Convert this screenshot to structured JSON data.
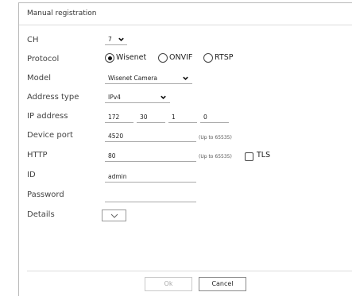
{
  "dialog": {
    "title": "Manual registration"
  },
  "fields": {
    "ch": {
      "label": "CH",
      "value": "7"
    },
    "protocol": {
      "label": "Protocol",
      "options": [
        "Wisenet",
        "ONVIF",
        "RTSP"
      ],
      "selected": "Wisenet"
    },
    "model": {
      "label": "Model",
      "value": "Wisenet Camera"
    },
    "address_type": {
      "label": "Address type",
      "value": "IPv4"
    },
    "ip_address": {
      "label": "IP address",
      "octets": [
        "172",
        "30",
        "1",
        "0"
      ]
    },
    "device_port": {
      "label": "Device port",
      "value": "4520",
      "hint": "(Up to 65535)"
    },
    "http": {
      "label": "HTTP",
      "value": "80",
      "hint": "(Up to 65535)",
      "tls_label": "TLS",
      "tls_checked": false
    },
    "id": {
      "label": "ID",
      "value": "admin"
    },
    "password": {
      "label": "Password",
      "value": ""
    },
    "details": {
      "label": "Details"
    }
  },
  "buttons": {
    "ok": "Ok",
    "cancel": "Cancel",
    "ok_enabled": false
  },
  "icons": {
    "dropdown": "chevron-down-icon",
    "expand": "chevron-down-icon"
  }
}
